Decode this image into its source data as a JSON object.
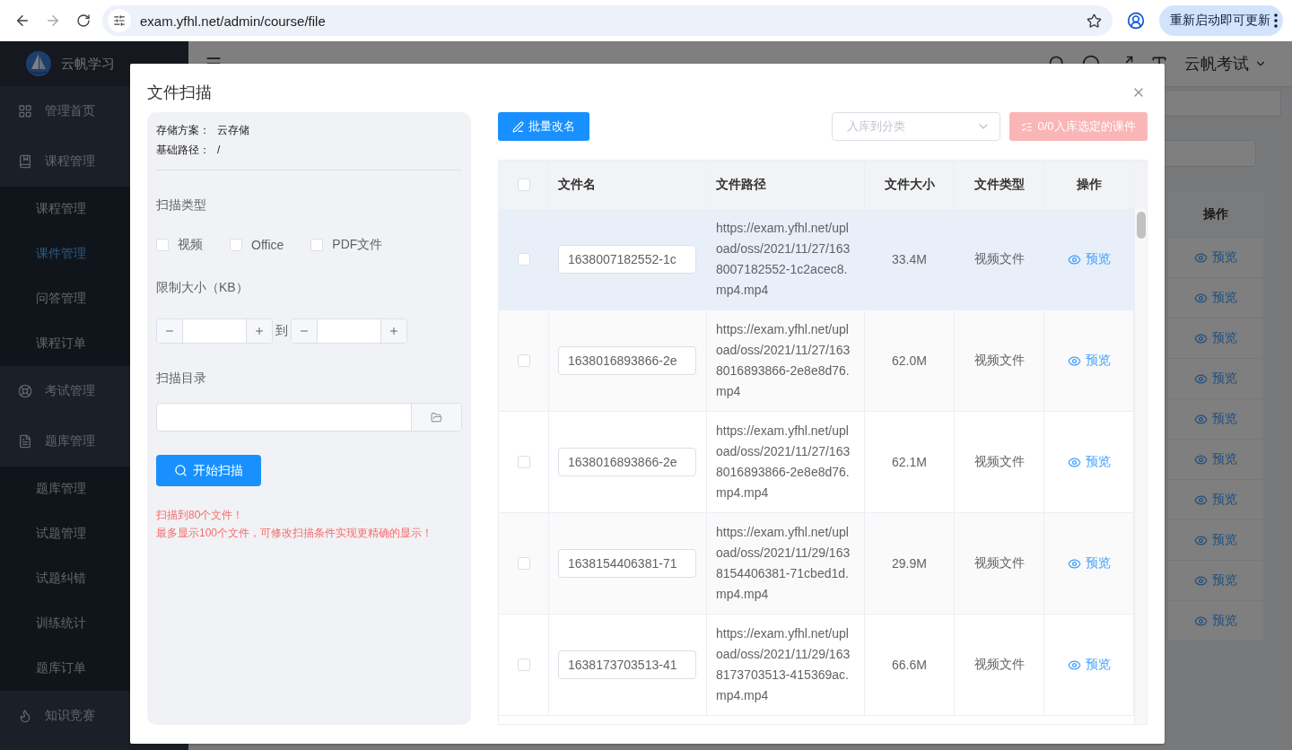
{
  "browser": {
    "url": "exam.yfhl.net/admin/course/file",
    "forward_disabled": true,
    "update_button": "重新启动即可更新"
  },
  "app": {
    "title": "云帆学习",
    "user": "云帆考试",
    "sidebar": [
      {
        "label": "管理首页",
        "kind": "grid"
      },
      {
        "label": "课程管理",
        "kind": "book",
        "expanded": true,
        "children": [
          {
            "label": "课程管理",
            "selected": false
          },
          {
            "label": "课件管理",
            "selected": true
          },
          {
            "label": "问答管理",
            "selected": false
          },
          {
            "label": "课程订单",
            "selected": false
          }
        ]
      },
      {
        "label": "考试管理",
        "kind": "lifebuoy"
      },
      {
        "label": "题库管理",
        "kind": "document",
        "expanded": true,
        "children": [
          {
            "label": "题库管理",
            "selected": false
          },
          {
            "label": "试题管理",
            "selected": false
          },
          {
            "label": "试题纠错",
            "selected": false
          },
          {
            "label": "训练统计",
            "selected": false
          },
          {
            "label": "题库订单",
            "selected": false
          }
        ]
      },
      {
        "label": "知识竞赛",
        "kind": "flame"
      }
    ],
    "background_table": {
      "column": "操作",
      "rows": [
        "预览",
        "预览",
        "预览",
        "预览",
        "预览",
        "预览",
        "预览",
        "预览",
        "预览",
        "预览"
      ]
    }
  },
  "dialog": {
    "title": "文件扫描",
    "storage": [
      {
        "label": "存储方案：",
        "value": "云存储"
      },
      {
        "label": "基础路径：",
        "value": "/"
      }
    ],
    "scan_type_label": "扫描类型",
    "scan_types": [
      {
        "label": "视频",
        "checked": false
      },
      {
        "label": "Office",
        "checked": false
      },
      {
        "label": "PDF文件",
        "checked": false
      }
    ],
    "size_label": "限制大小（KB）",
    "size_separator": "到",
    "directory_label": "扫描目录",
    "scan_button": "开始扫描",
    "messages": [
      "扫描到80个文件！",
      "最多显示100个文件，可修改扫描条件实现更精确的显示！"
    ],
    "rename_button": "批量改名",
    "category_select": {
      "placeholder": "入库到分类"
    },
    "import_button": {
      "label": "0/0入库选定的课件",
      "disabled": true
    },
    "table": {
      "select_all": {
        "checked": false
      },
      "columns": [
        "文件名",
        "文件路径",
        "文件大小",
        "文件类型",
        "操作"
      ],
      "rows": [
        {
          "checked": false,
          "highlighted": true,
          "name": "1638007182552-1c",
          "path": "https://exam.yfhl.net/upload/oss/2021/11/27/1638007182552-1c2acec8.mp4.mp4",
          "size": "33.4M",
          "type": "视频文件",
          "action": "预览"
        },
        {
          "checked": false,
          "highlighted": false,
          "name": "1638016893866-2e",
          "path": "https://exam.yfhl.net/upload/oss/2021/11/27/1638016893866-2e8e8d76.mp4",
          "size": "62.0M",
          "type": "视频文件",
          "action": "预览"
        },
        {
          "checked": false,
          "highlighted": false,
          "name": "1638016893866-2e",
          "path": "https://exam.yfhl.net/upload/oss/2021/11/27/1638016893866-2e8e8d76.mp4.mp4",
          "size": "62.1M",
          "type": "视频文件",
          "action": "预览"
        },
        {
          "checked": false,
          "highlighted": false,
          "name": "1638154406381-71",
          "path": "https://exam.yfhl.net/upload/oss/2021/11/29/1638154406381-71cbed1d.mp4.mp4",
          "size": "29.9M",
          "type": "视频文件",
          "action": "预览"
        },
        {
          "checked": false,
          "highlighted": false,
          "name": "1638173703513-41",
          "path": "https://exam.yfhl.net/upload/oss/2021/11/29/1638173703513-415369ac.mp4.mp4",
          "size": "66.6M",
          "type": "视频文件",
          "action": "预览"
        }
      ]
    }
  }
}
